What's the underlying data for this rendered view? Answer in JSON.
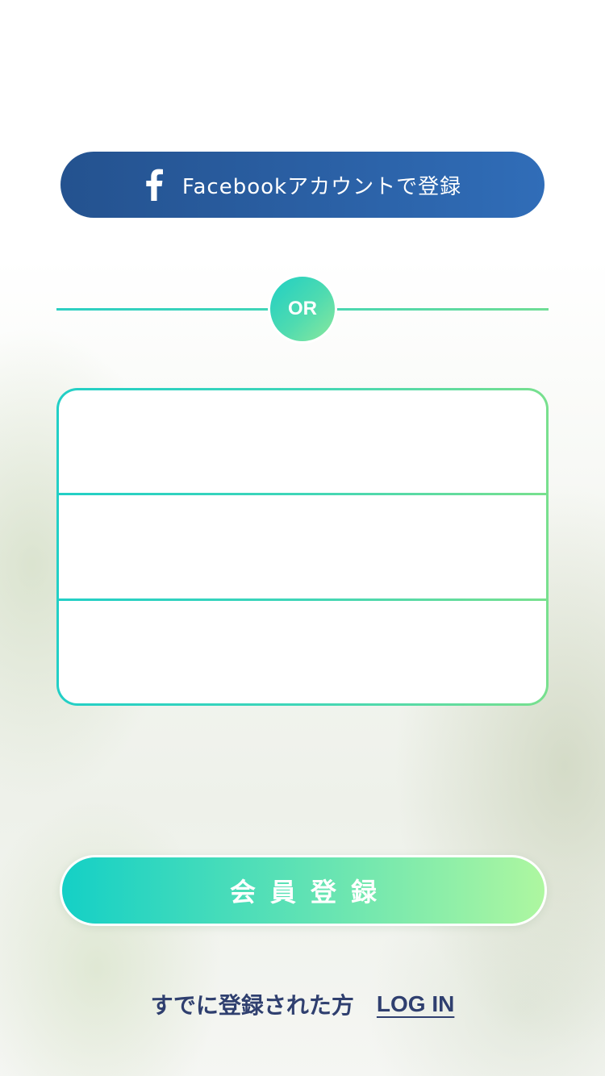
{
  "facebook_button": {
    "icon": "facebook-icon",
    "label": "Facebookアカウントで登録"
  },
  "divider": {
    "or_label": "OR"
  },
  "form": {
    "fields": [
      {
        "value": "",
        "placeholder": ""
      },
      {
        "value": "",
        "placeholder": ""
      },
      {
        "value": "",
        "placeholder": ""
      }
    ]
  },
  "register_button": {
    "label": "会員登録"
  },
  "login": {
    "prompt": "すでに登録された方",
    "link_label": "LOG IN"
  },
  "colors": {
    "facebook_blue": "#2a5fa3",
    "accent_teal": "#14d0c6",
    "accent_green": "#aef7a0",
    "text_navy": "#2f3f6f"
  }
}
